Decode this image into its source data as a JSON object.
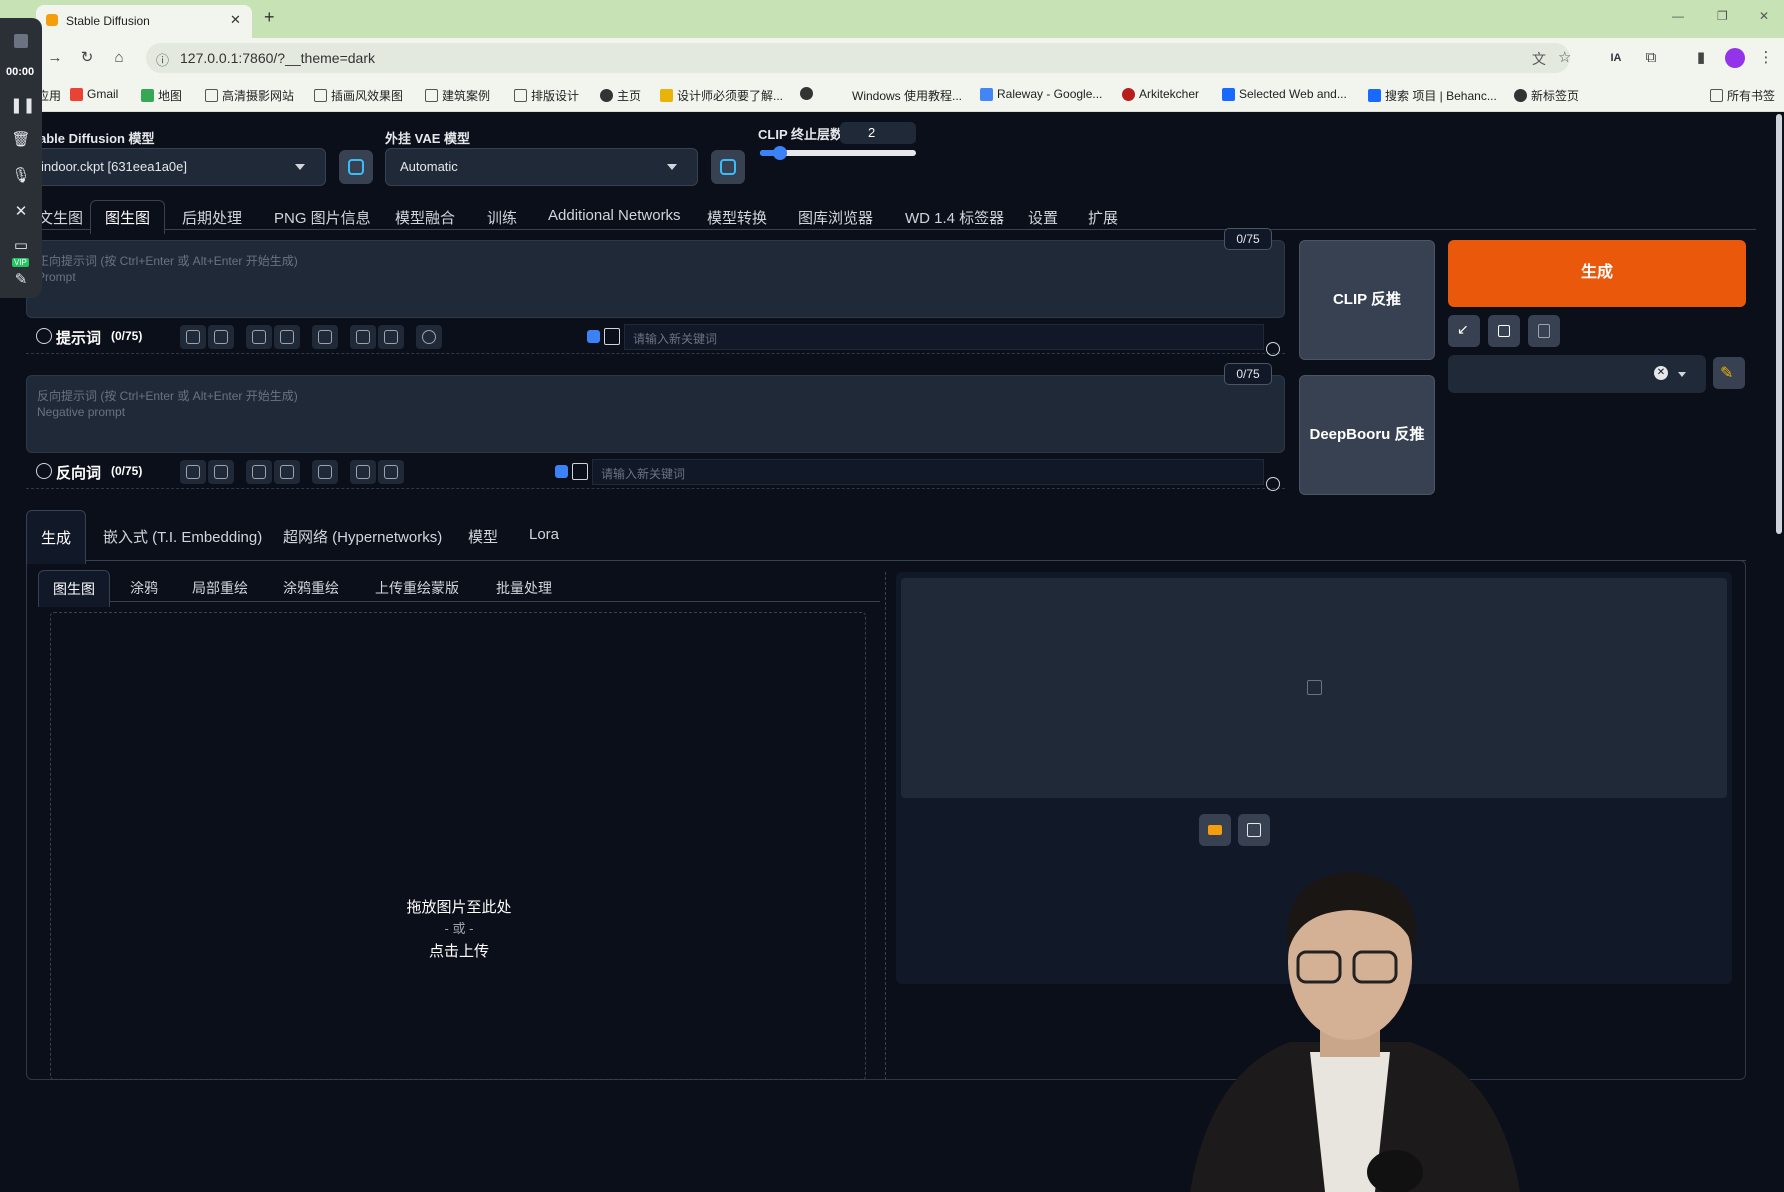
{
  "browser": {
    "tab_title": "Stable Diffusion",
    "new_tab": "+",
    "url": "127.0.0.1:7860/?__theme=dark",
    "window_controls": {
      "minimize": "—",
      "restore": "❐",
      "close": "✕"
    },
    "bookmarks": [
      {
        "label": "应用",
        "icon": "apps-icon"
      },
      {
        "label": "Gmail",
        "icon": "gmail-icon"
      },
      {
        "label": "地图",
        "icon": "maps-icon"
      },
      {
        "label": "高清摄影网站",
        "icon": "folder-icon"
      },
      {
        "label": "插画风效果图",
        "icon": "folder-icon"
      },
      {
        "label": "建筑案例",
        "icon": "folder-icon"
      },
      {
        "label": "排版设计",
        "icon": "folder-icon"
      },
      {
        "label": "主页",
        "icon": "globe-icon"
      },
      {
        "label": "设计师必须要了解...",
        "icon": "site-icon"
      },
      {
        "label": "",
        "icon": "globe-icon"
      },
      {
        "label": "Windows 使用教程...",
        "icon": "windows-icon"
      },
      {
        "label": "Raleway - Google...",
        "icon": "google-fonts-icon"
      },
      {
        "label": "Arkitekcher",
        "icon": "site-icon"
      },
      {
        "label": "Selected Web and...",
        "icon": "behance-icon"
      },
      {
        "label": "搜索 项目 | Behanc...",
        "icon": "behance-icon"
      },
      {
        "label": "新标签页",
        "icon": "globe-icon"
      }
    ],
    "all_bookmarks": "所有书签"
  },
  "recorder": {
    "timer": "00:00",
    "vip": "VIP"
  },
  "header": {
    "model_label": "Stable Diffusion 模型",
    "model_value": "indoor.ckpt [631eea1a0e]",
    "vae_label": "外挂 VAE 模型",
    "vae_value": "Automatic",
    "clip_label": "CLIP 终止层数",
    "clip_value": "2",
    "clip_slider_fraction": 0.13
  },
  "main_tabs": [
    "文生图",
    "图生图",
    "后期处理",
    "PNG 图片信息",
    "模型融合",
    "训练",
    "Additional Networks",
    "模型转换",
    "图库浏览器",
    "WD 1.4 标签器",
    "设置",
    "扩展"
  ],
  "active_main_tab": "图生图",
  "prompt": {
    "placeholder_line1": "正向提示词 (按 Ctrl+Enter 或 Alt+Enter 开始生成)",
    "placeholder_line2": "Prompt",
    "counter": "0/75",
    "section_label": "提示词",
    "section_count": "(0/75)",
    "keyword_placeholder": "请输入新关键词"
  },
  "negative": {
    "placeholder_line1": "反向提示词 (按 Ctrl+Enter 或 Alt+Enter 开始生成)",
    "placeholder_line2": "Negative prompt",
    "counter": "0/75",
    "section_label": "反向词",
    "section_count": "(0/75)",
    "keyword_placeholder": "请输入新关键词"
  },
  "buttons": {
    "clip_interrogate": "CLIP 反推",
    "deepbooru_interrogate": "DeepBooru 反推",
    "generate": "生成"
  },
  "sub_tabs": [
    "生成",
    "嵌入式 (T.I. Embedding)",
    "超网络 (Hypernetworks)",
    "模型",
    "Lora"
  ],
  "mode_tabs": [
    "图生图",
    "涂鸦",
    "局部重绘",
    "涂鸦重绘",
    "上传重绘蒙版",
    "批量处理"
  ],
  "upload": {
    "line1": "拖放图片至此处",
    "line2": "- 或 -",
    "line3": "点击上传"
  },
  "colors": {
    "generate": "#ea580c",
    "accent_blue": "#3b82f6",
    "app_bg": "#0b0f19",
    "panel_bg": "#1f2937"
  }
}
